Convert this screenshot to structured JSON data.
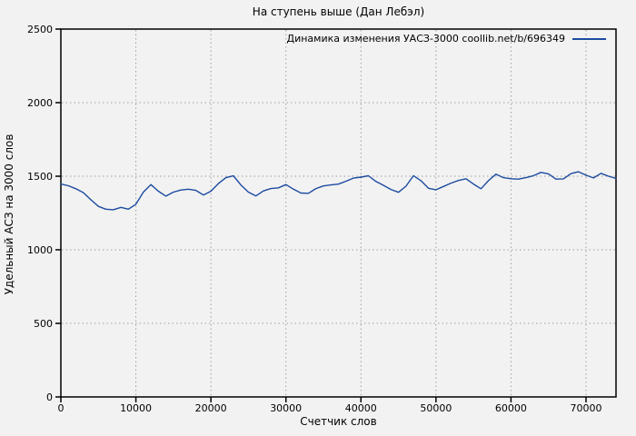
{
  "chart_data": {
    "type": "line",
    "title": "На ступень выше (Дан Лебэл)",
    "xlabel": "Счетчик слов",
    "ylabel": "Удельный АСЗ на 3000 слов",
    "xlim": [
      0,
      74000
    ],
    "ylim": [
      0,
      2500
    ],
    "xticks": [
      0,
      10000,
      20000,
      30000,
      40000,
      50000,
      60000,
      70000
    ],
    "yticks": [
      0,
      500,
      1000,
      1500,
      2000,
      2500
    ],
    "grid": true,
    "legend_position": "top-right-inside",
    "colors": {
      "line": "#1c4ba0",
      "background": "#f2f2f2",
      "grid": "#9e9e9e",
      "axis": "#000000",
      "text": "#000000"
    },
    "series": [
      {
        "name": "Динамика изменения УАСЗ-3000 coollib.net/b/696349",
        "color": "#1c4ba0",
        "x": [
          0,
          1000,
          2000,
          3000,
          4000,
          5000,
          6000,
          7000,
          8000,
          9000,
          10000,
          11000,
          12000,
          13000,
          14000,
          15000,
          16000,
          17000,
          18000,
          19000,
          20000,
          21000,
          22000,
          23000,
          24000,
          25000,
          26000,
          27000,
          28000,
          29000,
          30000,
          31000,
          32000,
          33000,
          34000,
          35000,
          36000,
          37000,
          38000,
          39000,
          40000,
          41000,
          42000,
          43000,
          44000,
          45000,
          46000,
          47000,
          48000,
          49000,
          50000,
          51000,
          52000,
          53000,
          54000,
          55000,
          56000,
          57000,
          58000,
          59000,
          60000,
          61000,
          62000,
          63000,
          64000,
          65000,
          66000,
          67000,
          68000,
          69000,
          70000,
          71000,
          72000,
          73000,
          74000
        ],
        "values": [
          1447,
          1435,
          1415,
          1388,
          1340,
          1295,
          1276,
          1272,
          1288,
          1276,
          1310,
          1392,
          1443,
          1398,
          1365,
          1392,
          1406,
          1412,
          1404,
          1372,
          1398,
          1450,
          1490,
          1503,
          1440,
          1392,
          1366,
          1400,
          1416,
          1421,
          1443,
          1412,
          1386,
          1384,
          1416,
          1434,
          1441,
          1446,
          1466,
          1487,
          1494,
          1503,
          1464,
          1438,
          1410,
          1391,
          1432,
          1504,
          1470,
          1418,
          1408,
          1430,
          1453,
          1471,
          1483,
          1447,
          1415,
          1470,
          1514,
          1490,
          1483,
          1480,
          1490,
          1504,
          1526,
          1516,
          1480,
          1482,
          1518,
          1530,
          1507,
          1488,
          1520,
          1500,
          1485
        ]
      }
    ]
  }
}
